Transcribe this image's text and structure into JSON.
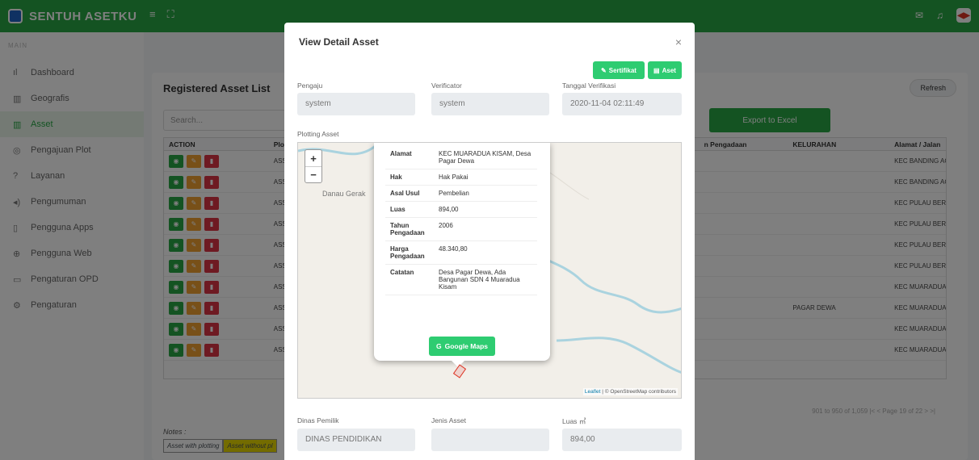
{
  "app": {
    "brand": "SENTUH ASETKU",
    "menu_icon": "menu-icon",
    "expand_icon": "expand-icon"
  },
  "topbar": {
    "mail_icon": "mail-icon",
    "bell_icon": "bell-icon"
  },
  "sidebar": {
    "section": "MAIN",
    "items": [
      {
        "label": "Dashboard",
        "icon": "chart-icon",
        "glyph": "ıl"
      },
      {
        "label": "Geografis",
        "icon": "map-icon",
        "glyph": "▥"
      },
      {
        "label": "Asset",
        "icon": "book-icon",
        "glyph": "▥",
        "active": true
      },
      {
        "label": "Pengajuan Plot",
        "icon": "pin-icon",
        "glyph": "◎"
      },
      {
        "label": "Layanan",
        "icon": "help-icon",
        "glyph": "?"
      },
      {
        "label": "Pengumuman",
        "icon": "speaker-icon",
        "glyph": "◂)"
      },
      {
        "label": "Pengguna Apps",
        "icon": "phone-icon",
        "glyph": "▯"
      },
      {
        "label": "Pengguna Web",
        "icon": "globe-icon",
        "glyph": "⊕"
      },
      {
        "label": "Pengaturan OPD",
        "icon": "monitor-icon",
        "glyph": "▭"
      },
      {
        "label": "Pengaturan",
        "icon": "settings-icon",
        "glyph": "⚙"
      }
    ]
  },
  "asset_list": {
    "title": "Registered Asset List",
    "refresh": "Refresh",
    "search_placeholder": "Search...",
    "export": "Export to Excel",
    "headers": [
      "ACTION",
      "Plot",
      "n Pengadaan",
      "KELURAHAN",
      "Alamat / Jalan"
    ],
    "rows": [
      {
        "plot": "ASSE",
        "kelurahan": "",
        "alamat": "KEC BANDING AG"
      },
      {
        "plot": "ASSE",
        "kelurahan": "",
        "alamat": "KEC BANDING AG"
      },
      {
        "plot": "ASSE",
        "kelurahan": "",
        "alamat": "KEC PULAU BERII"
      },
      {
        "plot": "ASSE",
        "kelurahan": "",
        "alamat": "KEC PULAU BERII"
      },
      {
        "plot": "ASSE",
        "kelurahan": "",
        "alamat": "KEC PULAU BERII"
      },
      {
        "plot": "ASSE",
        "kelurahan": "",
        "alamat": "KEC PULAU BERII"
      },
      {
        "plot": "ASSE",
        "kelurahan": "",
        "alamat": "KEC MUARADUA"
      },
      {
        "plot": "ASSE",
        "kelurahan": "PAGAR DEWA",
        "alamat": "KEC MUARADUA"
      },
      {
        "plot": "ASSE",
        "kelurahan": "",
        "alamat": "KEC MUARADUA"
      },
      {
        "plot": "ASSE",
        "kelurahan": "",
        "alamat": "KEC MUARADUA"
      }
    ],
    "pager": "901 to 950 of 1,059   |<  <  Page 19 of 22  >  >|",
    "notes_label": "Notes :",
    "legend_with": "Asset with plotting",
    "legend_without": "Asset without pl"
  },
  "modal": {
    "title": "View Detail Asset",
    "close": "×",
    "btn_sertifikat": "Sertifikat",
    "btn_aset": "Aset",
    "pengaju_label": "Pengaju",
    "pengaju_value": "system",
    "verificator_label": "Verificator",
    "verificator_value": "system",
    "tanggal_label": "Tanggal Verifikasi",
    "tanggal_value": "2020-11-04 02:11:49",
    "plotting_label": "Plotting Asset",
    "map_place": "Danau Gerak",
    "zoom_in": "+",
    "zoom_out": "−",
    "attribution_leaflet": "Leaflet",
    "attribution_rest": " | © OpenStreetMap contributors",
    "popup": [
      {
        "k": "Alamat",
        "v": "KEC MUARADUA KISAM, Desa Pagar Dewa"
      },
      {
        "k": "Hak",
        "v": "Hak Pakai"
      },
      {
        "k": "Asal Usul",
        "v": "Pembelian"
      },
      {
        "k": "Luas",
        "v": "894,00"
      },
      {
        "k": "Tahun Pengadaan",
        "v": "2006"
      },
      {
        "k": "Harga Pengadaan",
        "v": "48.340,80"
      },
      {
        "k": "Catatan",
        "v": "Desa Pagar Dewa, Ada Bangunan SDN 4 Muaradua Kisam"
      }
    ],
    "google_maps": "Google Maps",
    "dinas_label": "Dinas Pemilik",
    "dinas_value": "DINAS PENDIDIKAN",
    "jenis_label": "Jenis Asset",
    "jenis_value": "",
    "luas_label": "Luas",
    "luas_unit": "㎡",
    "luas_value": "894,00"
  }
}
